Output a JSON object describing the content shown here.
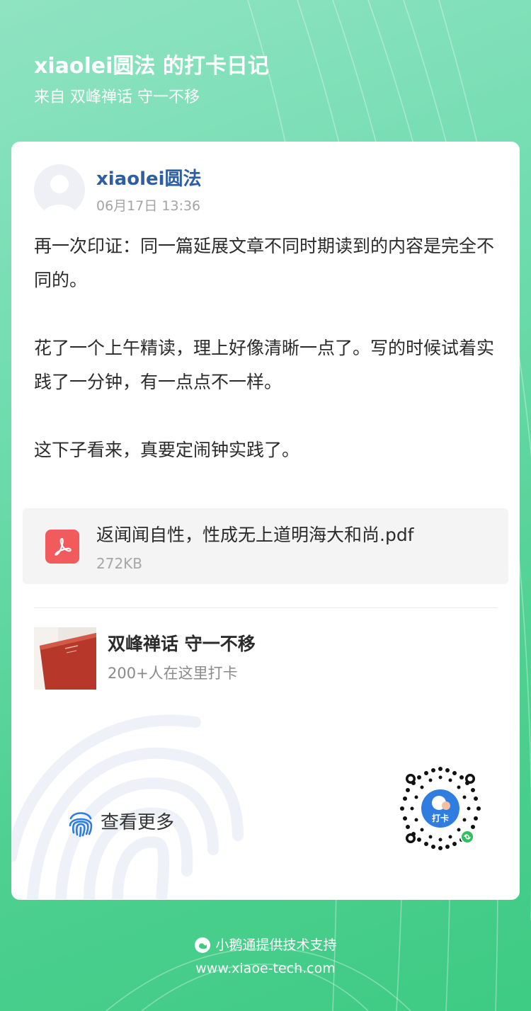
{
  "header": {
    "title": "xiaolei圆法 的打卡日记",
    "subtitle": "来自 双峰禅话 守一不移"
  },
  "post": {
    "author": "xiaolei圆法",
    "time": "06月17日 13:36",
    "paragraphs": [
      "再一次印证：同一篇延展文章不同时期读到的内容是完全不同的。",
      "花了一个上午精读，理上好像清晰一点了。写的时候试着实践了一分钟，有一点点不一样。",
      "这下子看来，真要定闹钟实践了。"
    ],
    "attachment": {
      "name": "返闻闻自性，性成无上道明海大和尚.pdf",
      "size": "272KB",
      "icon": "pdf-icon"
    }
  },
  "camp": {
    "name": "双峰禅话 守一不移",
    "count": "200+人在这里打卡"
  },
  "view_more": {
    "label": "查看更多",
    "icon": "fingerprint-icon"
  },
  "qr": {
    "badge_label": "打卡"
  },
  "footer": {
    "provider": "小鹅通提供技术支持",
    "url": "www.xiaoe-tech.com"
  },
  "colors": {
    "background": "#4fd092",
    "author": "#2f5fa3",
    "pdf": "#f15b5b",
    "view_more_icon": "#2d7be5"
  }
}
